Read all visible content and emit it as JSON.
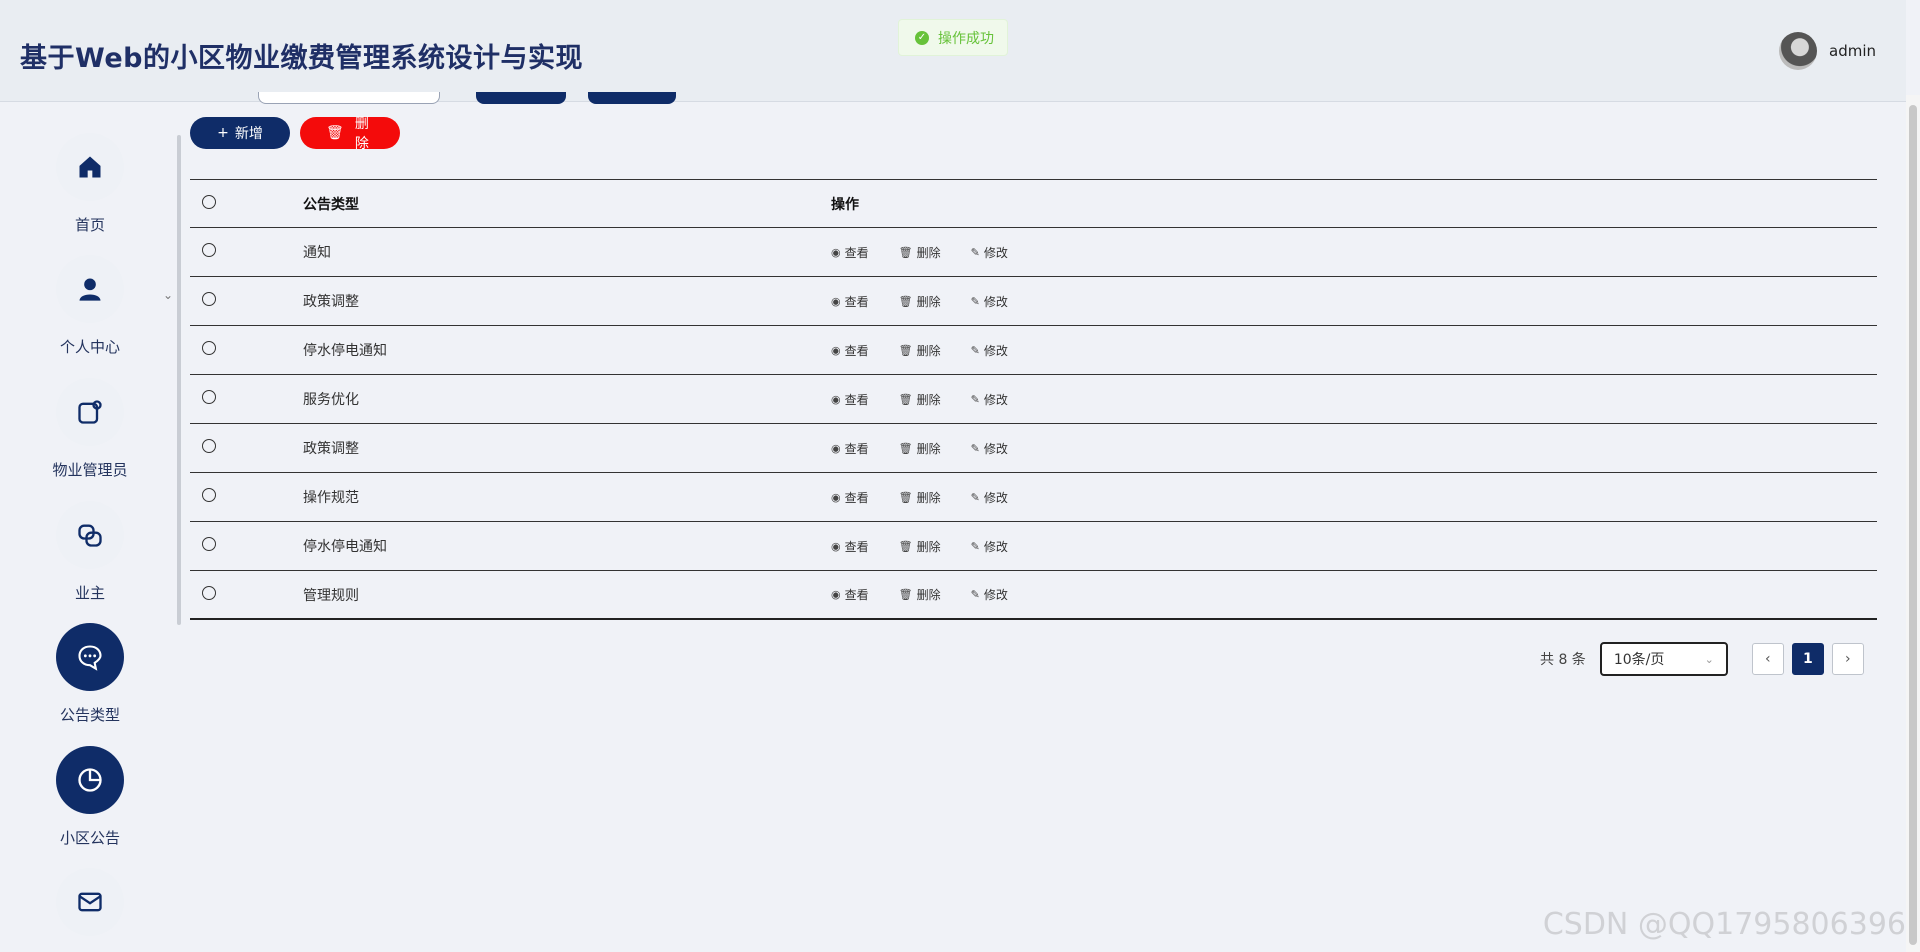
{
  "header": {
    "title": "基于Web的小区物业缴费管理系统设计与实现",
    "username": "admin"
  },
  "toast": {
    "message": "操作成功"
  },
  "sidebar": {
    "items": [
      {
        "label": "首页",
        "icon": "home-icon"
      },
      {
        "label": "个人中心",
        "icon": "user-icon"
      },
      {
        "label": "物业管理员",
        "icon": "admin-icon"
      },
      {
        "label": "业主",
        "icon": "owner-icon"
      },
      {
        "label": "公告类型",
        "icon": "chat-icon"
      },
      {
        "label": "小区公告",
        "icon": "pie-chart-icon"
      },
      {
        "label": "",
        "icon": "mail-icon"
      }
    ]
  },
  "toolbar": {
    "add_label": "新增",
    "delete_label": "删除"
  },
  "table": {
    "headers": {
      "type": "公告类型",
      "ops": "操作"
    },
    "actions": {
      "view": "查看",
      "delete": "删除",
      "edit": "修改"
    },
    "rows": [
      "通知",
      "政策调整",
      "停水停电通知",
      "服务优化",
      "政策调整",
      "操作规范",
      "停水停电通知",
      "管理规则"
    ]
  },
  "pager": {
    "total": "共 8 条",
    "page_size": "10条/页",
    "current": "1"
  },
  "watermark": "CSDN @QQ1795806396",
  "colors": {
    "primary": "#0f2c68",
    "danger": "#f40b0b",
    "success": "#67c23a"
  }
}
